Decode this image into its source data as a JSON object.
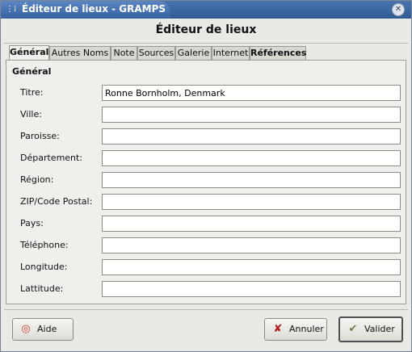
{
  "window": {
    "title": "Éditeur de lieux - GRAMPS"
  },
  "header": {
    "title": "Éditeur de lieux"
  },
  "tabs": [
    {
      "label": "Général"
    },
    {
      "label": "Autres Noms"
    },
    {
      "label": "Note"
    },
    {
      "label": "Sources"
    },
    {
      "label": "Galerie"
    },
    {
      "label": "Internet"
    },
    {
      "label": "Références"
    }
  ],
  "section_title": "Général",
  "fields": {
    "titre": {
      "label": "Titre:",
      "value": "Ronne Bornholm, Denmark"
    },
    "ville": {
      "label": "Ville:",
      "value": ""
    },
    "paroisse": {
      "label": "Paroisse:",
      "value": ""
    },
    "departement": {
      "label": "Département:",
      "value": ""
    },
    "region": {
      "label": "Région:",
      "value": ""
    },
    "zip": {
      "label": "ZIP/Code Postal:",
      "value": ""
    },
    "pays": {
      "label": "Pays:",
      "value": ""
    },
    "telephone": {
      "label": "Téléphone:",
      "value": ""
    },
    "longitude": {
      "label": "Longitude:",
      "value": ""
    },
    "latitude": {
      "label": "Lattitude:",
      "value": ""
    }
  },
  "buttons": {
    "aide": "Aide",
    "annuler": "Annuler",
    "valider": "Valider"
  },
  "icons": {
    "help": "lifebuoy-icon",
    "cancel": "cross-icon",
    "ok": "checkmark-hand-icon",
    "window_close": "close-icon"
  }
}
